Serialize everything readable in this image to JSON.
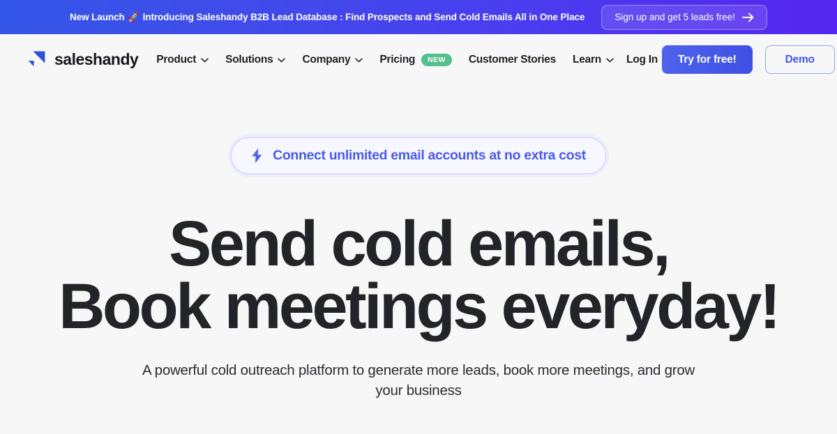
{
  "banner": {
    "prefix": "New Launch",
    "rocket_emoji": "🚀",
    "message": "Introducing Saleshandy B2B Lead Database : Find Prospects and Send Cold Emails All in One Place",
    "cta_label": "Sign up and get 5 leads free!",
    "gradient_start": "#3456e8",
    "gradient_end": "#5526ef"
  },
  "header": {
    "brand": "saleshandy",
    "nav": [
      {
        "label": "Product",
        "has_dropdown": true
      },
      {
        "label": "Solutions",
        "has_dropdown": true
      },
      {
        "label": "Company",
        "has_dropdown": true
      },
      {
        "label": "Pricing",
        "has_dropdown": false,
        "badge": "NEW"
      },
      {
        "label": "Customer Stories",
        "has_dropdown": false
      },
      {
        "label": "Learn",
        "has_dropdown": true
      }
    ],
    "login_label": "Log In",
    "try_label": "Try for free!",
    "demo_label": "Demo",
    "badge_color": "#53c08d",
    "primary_color": "#4257e4"
  },
  "hero": {
    "pill_label": "Connect unlimited email accounts at no extra cost",
    "pill_icon": "lightning-bolt-icon",
    "pill_color": "#4a5ae8",
    "headline_line1": "Send cold emails,",
    "headline_line2": "Book meetings everyday!",
    "subheading": "A powerful cold outreach platform to generate more leads, book more meetings, and grow your business"
  }
}
